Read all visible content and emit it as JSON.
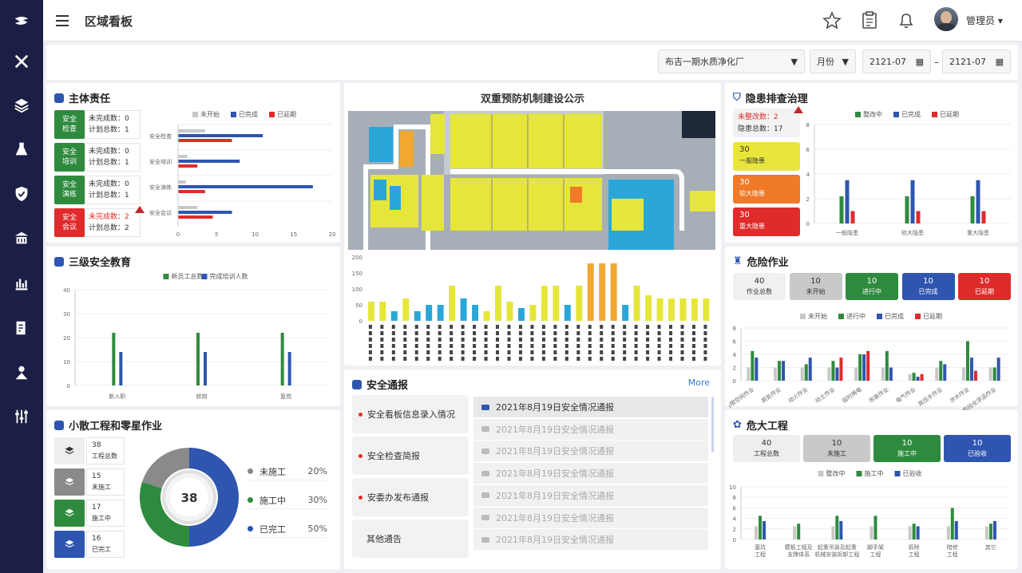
{
  "header": {
    "title": "区域看板",
    "user": "管理员"
  },
  "filters": {
    "site": "布吉一期水质净化厂",
    "period": "月份",
    "start": "2121-07",
    "sep": "–",
    "end": "2121-07"
  },
  "colors": {
    "green": "#2e8b3e",
    "blue": "#2f55b0",
    "red": "#e02b2b",
    "gray": "#c8c8c8",
    "yellow": "#e6e63a",
    "orange": "#f07a28",
    "cyan": "#2aa7d8"
  },
  "main_resp": {
    "title": "主体责任",
    "items": [
      {
        "name": "安全\n检查",
        "l1": "未完成数：",
        "v1": "0",
        "l2": "计划总数：",
        "v2": "1",
        "color": "#2e8b3e"
      },
      {
        "name": "安全\n培训",
        "l1": "未完成数：",
        "v1": "0",
        "l2": "计划总数：",
        "v2": "1",
        "color": "#2e8b3e"
      },
      {
        "name": "安全\n演练",
        "l1": "未完成数：",
        "v1": "0",
        "l2": "计划总数：",
        "v2": "1",
        "color": "#2e8b3e"
      },
      {
        "name": "安全\n会议",
        "l1": "未完成数：",
        "v1": "2",
        "l2": "计划总数：",
        "v2": "2",
        "color": "#e02b2b"
      }
    ]
  },
  "double_prev": {
    "title": "双重预防机制建设公示"
  },
  "hazard": {
    "title": "隐患排查治理",
    "summary": {
      "l1": "未整改数：",
      "v1": "2",
      "l2": "隐患总数：",
      "v2": "17"
    },
    "tiles": [
      {
        "num": "30",
        "label": "一般隐患",
        "bg": "#e8e63c",
        "fg": "#333"
      },
      {
        "num": "30",
        "label": "较大隐患",
        "bg": "#f07a28",
        "fg": "#fff"
      },
      {
        "num": "30",
        "label": "重大隐患",
        "bg": "#e02b2b",
        "fg": "#fff"
      }
    ]
  },
  "education": {
    "title": "三级安全教育"
  },
  "danger_work": {
    "title": "危险作业",
    "tiles": [
      {
        "num": "40",
        "label": "作业总数",
        "bg": "#f0f0f0",
        "fg": "#333"
      },
      {
        "num": "10",
        "label": "未开始",
        "bg": "#c9c9c9",
        "fg": "#333"
      },
      {
        "num": "10",
        "label": "进行中",
        "bg": "#2e8b3e",
        "fg": "#fff"
      },
      {
        "num": "10",
        "label": "已完成",
        "bg": "#2f55b0",
        "fg": "#fff"
      },
      {
        "num": "10",
        "label": "已延期",
        "bg": "#e02b2b",
        "fg": "#fff"
      }
    ]
  },
  "notice": {
    "title": "安全通报",
    "more": "More",
    "left": [
      "安全看板信息录入情况",
      "安全检查简报",
      "安委办发布通报",
      "其他通告"
    ],
    "rows": [
      "2021年8月19日安全情况通报",
      "2021年8月19日安全情况通报",
      "2021年8月19日安全情况通报",
      "2021年8月19日安全情况通报",
      "2021年8月19日安全情况通报",
      "2021年8月19日安全情况通报",
      "2021年8月19日安全情况通报"
    ]
  },
  "small_eng": {
    "title": "小散工程和零星作业",
    "tiles": [
      {
        "num": "38",
        "label": "工程总数",
        "bg": "#eeeeee",
        "fg": "#333"
      },
      {
        "num": "15",
        "label": "未施工",
        "bg": "#8a8a8a",
        "fg": "#fff"
      },
      {
        "num": "17",
        "label": "施工中",
        "bg": "#2e8b3e",
        "fg": "#fff"
      },
      {
        "num": "16",
        "label": "已完工",
        "bg": "#2f55b0",
        "fg": "#fff"
      }
    ],
    "donut_center": "38",
    "legend": [
      {
        "label": "未施工",
        "pct": "20%",
        "color": "#8a8a8a"
      },
      {
        "label": "施工中",
        "pct": "30%",
        "color": "#2e8b3e"
      },
      {
        "label": "已完工",
        "pct": "50%",
        "color": "#2f55b0"
      }
    ]
  },
  "big_eng": {
    "title": "危大工程",
    "tiles": [
      {
        "num": "40",
        "label": "工程总数",
        "bg": "#eeeeee",
        "fg": "#333"
      },
      {
        "num": "10",
        "label": "未施工",
        "bg": "#c9c9c9",
        "fg": "#333"
      },
      {
        "num": "10",
        "label": "施工中",
        "bg": "#2e8b3e",
        "fg": "#fff"
      },
      {
        "num": "10",
        "label": "已验收",
        "bg": "#2f55b0",
        "fg": "#fff"
      }
    ]
  },
  "chart_data": [
    {
      "id": "resp",
      "type": "bar",
      "orientation": "horizontal",
      "categories": [
        "安全检查",
        "安全培训",
        "安全演练",
        "安全会议"
      ],
      "series": [
        {
          "name": "未开始",
          "color": "#c8c8c8",
          "values": [
            3.5,
            1.2,
            1,
            2.5
          ]
        },
        {
          "name": "已完成",
          "color": "#2f55b0",
          "values": [
            11,
            8,
            17.5,
            7
          ]
        },
        {
          "name": "已延期",
          "color": "#e02b2b",
          "values": [
            7,
            2.5,
            3.5,
            4.5
          ]
        }
      ],
      "xticks": [
        "0",
        "5",
        "10",
        "15",
        "20"
      ],
      "xlim": [
        0,
        20
      ],
      "legend": "top"
    },
    {
      "id": "edu",
      "type": "bar",
      "categories": [
        "新入职",
        "转岗",
        "复岗"
      ],
      "series": [
        {
          "name": "新员工总数",
          "color": "#2e8b3e",
          "values": [
            22,
            22,
            22
          ]
        },
        {
          "name": "完成培训人数",
          "color": "#2f55b0",
          "values": [
            14,
            14,
            14
          ]
        }
      ],
      "yticks": [
        "0",
        "10",
        "20",
        "30",
        "40"
      ],
      "ylim": [
        0,
        40
      ],
      "legend": "top"
    },
    {
      "id": "hazard",
      "type": "bar",
      "categories": [
        "一般隐患",
        "较大隐患",
        "重大隐患"
      ],
      "series": [
        {
          "name": "整改中",
          "color": "#2e8b3e",
          "values": [
            2.2,
            2.2,
            2.2
          ]
        },
        {
          "name": "已完成",
          "color": "#2f55b0",
          "values": [
            3.5,
            3.5,
            3.5
          ]
        },
        {
          "name": "已延期",
          "color": "#e02b2b",
          "values": [
            1,
            1,
            1
          ]
        }
      ],
      "yticks": [
        "0",
        "2",
        "4",
        "6",
        "8"
      ],
      "ylim": [
        0,
        8
      ],
      "legend": "top"
    },
    {
      "id": "danger",
      "type": "bar",
      "categories": [
        "有限空间作业",
        "高处作业",
        "动火作业",
        "动土作业",
        "临时用电",
        "吊装作业",
        "电气作业",
        "高压水作业",
        "涉水作业",
        "危险化学品作业"
      ],
      "series": [
        {
          "name": "未开始",
          "color": "#c8c8c8",
          "values": [
            2,
            2,
            2,
            2,
            2,
            2,
            1,
            2,
            2,
            2
          ]
        },
        {
          "name": "进行中",
          "color": "#2e8b3e",
          "values": [
            4.5,
            3,
            2.5,
            3,
            4,
            4.5,
            1.2,
            3,
            6,
            2
          ]
        },
        {
          "name": "已完成",
          "color": "#2f55b0",
          "values": [
            3.5,
            3,
            3.5,
            2,
            4,
            2,
            0.6,
            2.5,
            3.5,
            3.5
          ]
        },
        {
          "name": "已延期",
          "color": "#e02b2b",
          "values": [
            0,
            0,
            0,
            3.5,
            4.5,
            0,
            1,
            0,
            1.5,
            0
          ]
        }
      ],
      "yticks": [
        "0",
        "2",
        "4",
        "6",
        "8"
      ],
      "ylim": [
        0,
        8
      ],
      "legend": "top"
    },
    {
      "id": "big",
      "type": "bar",
      "categories": [
        "基坑\n工程",
        "模板工程及\n支撑体系",
        "起重吊装及起重\n机械安装拆卸工程",
        "脚手架\n工程",
        "拆除\n工程",
        "暗挖\n工程",
        "其它"
      ],
      "series": [
        {
          "name": "整改中",
          "color": "#c8c8c8",
          "values": [
            2.5,
            2.5,
            2.5,
            2.5,
            2.5,
            2.5,
            2.5
          ]
        },
        {
          "name": "施工中",
          "color": "#2e8b3e",
          "values": [
            4.5,
            3,
            4.5,
            4.5,
            3,
            6,
            3
          ]
        },
        {
          "name": "已验收",
          "color": "#2f55b0",
          "values": [
            3.5,
            0,
            3.5,
            0,
            2.5,
            3.5,
            3.5
          ]
        }
      ],
      "yticks": [
        "0",
        "2",
        "4",
        "6",
        "8",
        "10"
      ],
      "ylim": [
        0,
        10
      ],
      "legend": "top"
    },
    {
      "id": "district",
      "type": "bar",
      "colors": [
        "#e6e63a",
        "#e6e63a",
        "#2aa7d8",
        "#e6e63a",
        "#2aa7d8",
        "#2aa7d8",
        "#2aa7d8",
        "#e6e63a",
        "#2aa7d8",
        "#2aa7d8",
        "#e6e63a",
        "#e6e63a",
        "#e6e63a",
        "#2aa7d8",
        "#e6e63a",
        "#e6e63a",
        "#e6e63a",
        "#2aa7d8",
        "#e6e63a",
        "#f0a830",
        "#f0a830",
        "#f0a830",
        "#2aa7d8",
        "#e6e63a",
        "#e6e63a",
        "#e6e63a",
        "#e6e63a",
        "#e6e63a",
        "#e6e63a",
        "#e6e63a"
      ],
      "values": [
        60,
        60,
        30,
        70,
        30,
        50,
        50,
        110,
        70,
        50,
        30,
        110,
        60,
        40,
        50,
        110,
        110,
        50,
        110,
        180,
        180,
        180,
        50,
        110,
        80,
        70,
        70,
        70,
        70,
        70
      ],
      "yticks": [
        "0",
        "50",
        "100",
        "150",
        "200"
      ],
      "ylim": [
        0,
        200
      ]
    },
    {
      "id": "donut",
      "type": "pie",
      "values": [
        20,
        30,
        50
      ],
      "colors": [
        "#8a8a8a",
        "#2e8b3e",
        "#2f55b0"
      ],
      "labels": [
        "未施工",
        "施工中",
        "已完工"
      ]
    }
  ]
}
